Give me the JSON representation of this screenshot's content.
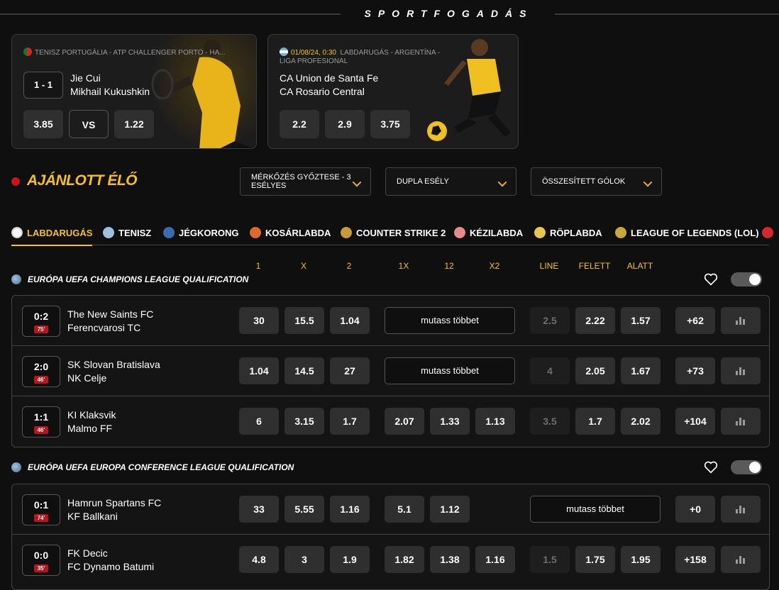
{
  "header": {
    "title": "SPORTFOGADÁS"
  },
  "promos": [
    {
      "meta": "TENISZ  PORTUGÁLIA - ATP CHALLENGER PORTO - HA...",
      "score": "1 - 1",
      "home": "Jie Cui",
      "away": "Mikhail Kukushkin",
      "odds": [
        "3.85",
        "VS",
        "1.22"
      ]
    },
    {
      "date": "01/08/24, 0:30",
      "meta": "LABDARUGÁS - ARGENTÍNA -",
      "meta2": "LIGA PROFESIONAL",
      "home": "CA Union de Santa Fe",
      "away": "CA Rosario Central",
      "odds": [
        "2.2",
        "2.9",
        "3.75"
      ]
    }
  ],
  "featured": {
    "title": "AJÁNLOTT ÉLŐ",
    "dropdowns": [
      "MÉRKŐZÉS GYŐZTESE - 3 ESÉLYES",
      "DUPLA ESÉLY",
      "ÖSSZESÍTETT GÓLOK"
    ]
  },
  "sports": [
    "LABDARUGÁS",
    "TENISZ",
    "JÉGKORONG",
    "KOSÁRLABDA",
    "COUNTER STRIKE 2",
    "KÉZILABDA",
    "RÖPLABDA",
    "LEAGUE OF LEGENDS (LOL)"
  ],
  "columns": [
    "1",
    "X",
    "2",
    "1X",
    "12",
    "X2",
    "LINE",
    "FELETT",
    "ALATT"
  ],
  "leagues": [
    {
      "name": "EURÓPA UEFA CHAMPIONS LEAGUE QUALIFICATION",
      "matches": [
        {
          "score": "0:2",
          "minute": "75'",
          "home": "The New Saints FC",
          "away": "Ferencvarosi TC",
          "o1": "30",
          "ox": "15.5",
          "o2": "1.04",
          "more": "mutass többet",
          "line": "2.5",
          "over": "2.22",
          "under": "1.57",
          "extra": "+62"
        },
        {
          "score": "2:0",
          "minute": "46'",
          "home": "SK Slovan Bratislava",
          "away": "NK Celje",
          "o1": "1.04",
          "ox": "14.5",
          "o2": "27",
          "more": "mutass többet",
          "line": "4",
          "over": "2.05",
          "under": "1.67",
          "extra": "+73"
        },
        {
          "score": "1:1",
          "minute": "46'",
          "home": "KI Klaksvik",
          "away": "Malmo FF",
          "o1": "6",
          "ox": "3.15",
          "o2": "1.7",
          "d1x": "2.07",
          "d12": "1.33",
          "dx2": "1.13",
          "line": "3.5",
          "over": "1.7",
          "under": "2.02",
          "extra": "+104"
        }
      ]
    },
    {
      "name": "EURÓPA UEFA EUROPA CONFERENCE LEAGUE QUALIFICATION",
      "matches": [
        {
          "score": "0:1",
          "minute": "74'",
          "home": "Hamrun Spartans FC",
          "away": "KF Ballkani",
          "o1": "33",
          "ox": "5.55",
          "o2": "1.16",
          "d1x": "5.1",
          "d12": "1.12",
          "more": "mutass többet",
          "extra": "+0"
        },
        {
          "score": "0:0",
          "minute": "35'",
          "home": "FK Decic",
          "away": "FC Dynamo Batumi",
          "o1": "4.8",
          "ox": "3",
          "o2": "1.9",
          "d1x": "1.82",
          "d12": "1.38",
          "dx2": "1.16",
          "line": "1.5",
          "over": "1.75",
          "under": "1.95",
          "extra": "+158"
        }
      ]
    }
  ]
}
